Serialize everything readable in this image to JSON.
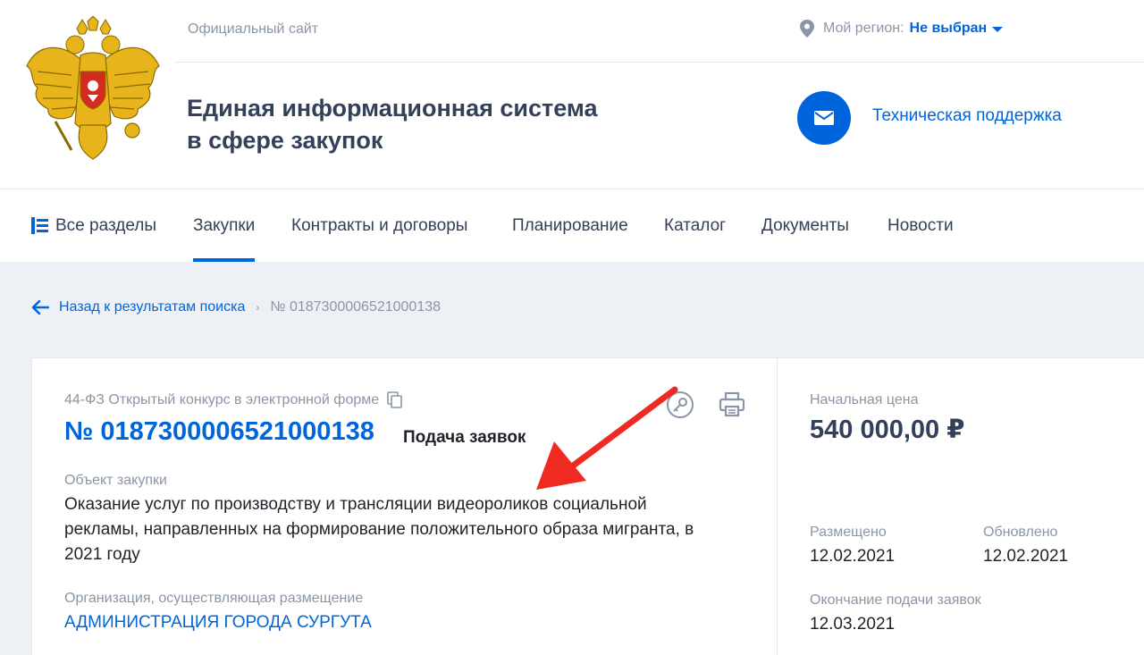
{
  "colors": {
    "accent": "#0065dd",
    "text": "#334059",
    "muted": "#8a96a8",
    "arrow": "#ee2a22",
    "bg": "#edf0f5"
  },
  "header": {
    "official_site": "Официальный сайт",
    "region_label": "Мой регион:",
    "region_value": "Не выбран",
    "title_line1": "Единая информационная система",
    "title_line2": "в сфере закупок",
    "support_label": "Техническая поддержка",
    "emblem_icon": "russian-coat-of-arms",
    "support_icon": "mail-icon"
  },
  "nav": {
    "items": [
      {
        "label": "Все разделы",
        "icon": "sections-icon"
      },
      {
        "label": "Закупки",
        "active": true
      },
      {
        "label": "Контракты и договоры"
      },
      {
        "label": "Планирование"
      },
      {
        "label": "Каталог"
      },
      {
        "label": "Документы"
      },
      {
        "label": "Новости"
      }
    ]
  },
  "breadcrumb": {
    "back_label": "Назад к результатам поиска",
    "separator": "›",
    "current": "№ 0187300006521000138"
  },
  "card": {
    "law_and_type": "44-ФЗ Открытый конкурс в электронной форме",
    "reg_number": "№ 0187300006521000138",
    "stage": "Подача заявок",
    "object_label": "Объект закупки",
    "object_text": "Оказание услуг по производству и трансляции видеороликов социальной рекламы, направленных на формирование положительного образа мигранта, в 2021 году",
    "org_label": "Организация, осуществляющая размещение",
    "org_name": "АДМИНИСТРАЦИЯ ГОРОДА СУРГУТА"
  },
  "side": {
    "price_label": "Начальная цена",
    "price_value": "540 000,00 ₽",
    "posted_label": "Размещено",
    "posted_value": "12.02.2021",
    "updated_label": "Обновлено",
    "updated_value": "12.02.2021",
    "deadline_label": "Окончание подачи заявок",
    "deadline_value": "12.03.2021"
  }
}
